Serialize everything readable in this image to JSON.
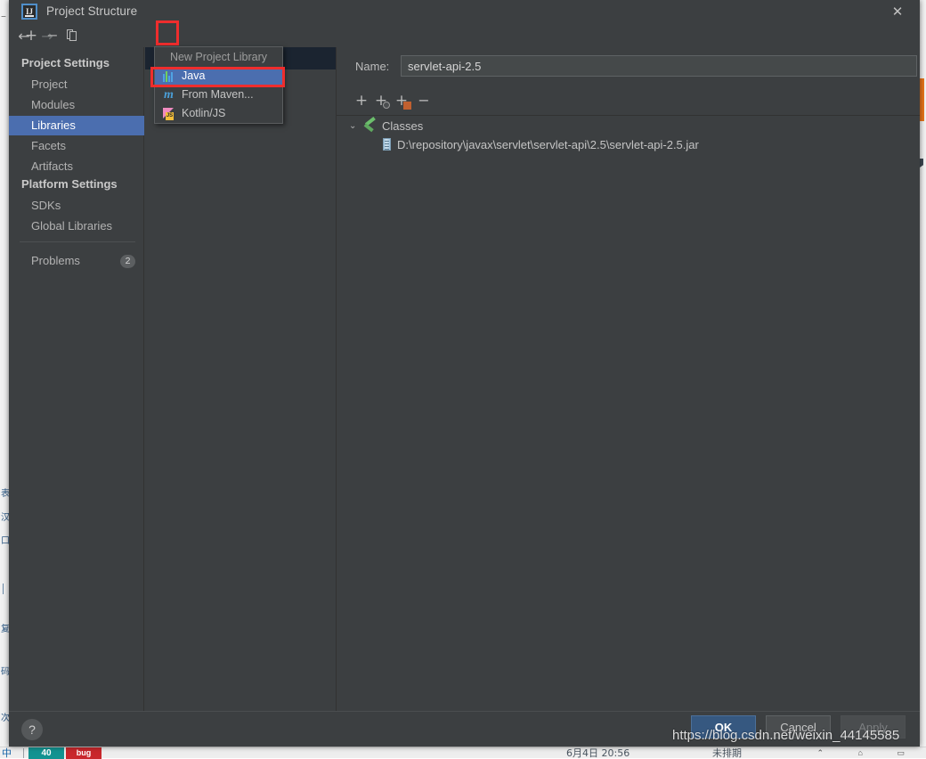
{
  "window": {
    "title": "Project Structure",
    "logo_text": "IJ",
    "close_icon": "✕",
    "minimize_icon": "–"
  },
  "nav": {
    "back_icon": "←",
    "forward_icon": "→"
  },
  "sidebar": {
    "groups": [
      {
        "label": "Project Settings"
      },
      {
        "label": "Platform Settings"
      }
    ],
    "items": [
      {
        "label": "Project",
        "selected": false
      },
      {
        "label": "Modules",
        "selected": false
      },
      {
        "label": "Libraries",
        "selected": true
      },
      {
        "label": "Facets",
        "selected": false
      },
      {
        "label": "Artifacts",
        "selected": false
      },
      {
        "label": "SDKs",
        "selected": false
      },
      {
        "label": "Global Libraries",
        "selected": false
      }
    ],
    "problems": {
      "label": "Problems",
      "count": "2"
    }
  },
  "list_toolbar": {
    "add_icon": "+",
    "remove_icon": "−",
    "copy_icon": "copy-icon"
  },
  "dropdown": {
    "header": "New Project Library",
    "items": [
      {
        "label": "Java",
        "icon": "java-icon",
        "selected": true
      },
      {
        "label": "From Maven...",
        "icon": "maven-icon",
        "selected": false
      },
      {
        "label": "Kotlin/JS",
        "icon": "kotlin-js-icon",
        "selected": false
      }
    ]
  },
  "detail": {
    "name_label": "Name:",
    "name_value": "servlet-api-2.5",
    "name_placeholder": "",
    "toolbar": {
      "add_icon": "+",
      "add_url_icon": "+",
      "add_jar_icon": "+",
      "remove_icon": "−"
    },
    "tree": {
      "root": {
        "chevron": "⌄",
        "label": "Classes"
      },
      "children": [
        {
          "label": "D:\\repository\\javax\\servlet\\servlet-api\\2.5\\servlet-api-2.5.jar"
        }
      ]
    }
  },
  "buttons": {
    "help": "?",
    "ok": "OK",
    "cancel": "Cancel",
    "apply": "Apply"
  },
  "watermark": "https://blog.csdn.net/weixin_44145585",
  "taskbar": {
    "ime_glyph": "中",
    "badge_count": "40",
    "badge_label": "bug",
    "date": "6月4日 20:56",
    "state": "未排期",
    "system_icons": "⌃ ⌂ ▭"
  },
  "colors": {
    "dialog_bg": "#3c3f41",
    "selection_blue": "#4b6eaf",
    "ok_button": "#365880",
    "highlight_red": "#ef2d2d",
    "accent_orange": "#e8751a"
  }
}
